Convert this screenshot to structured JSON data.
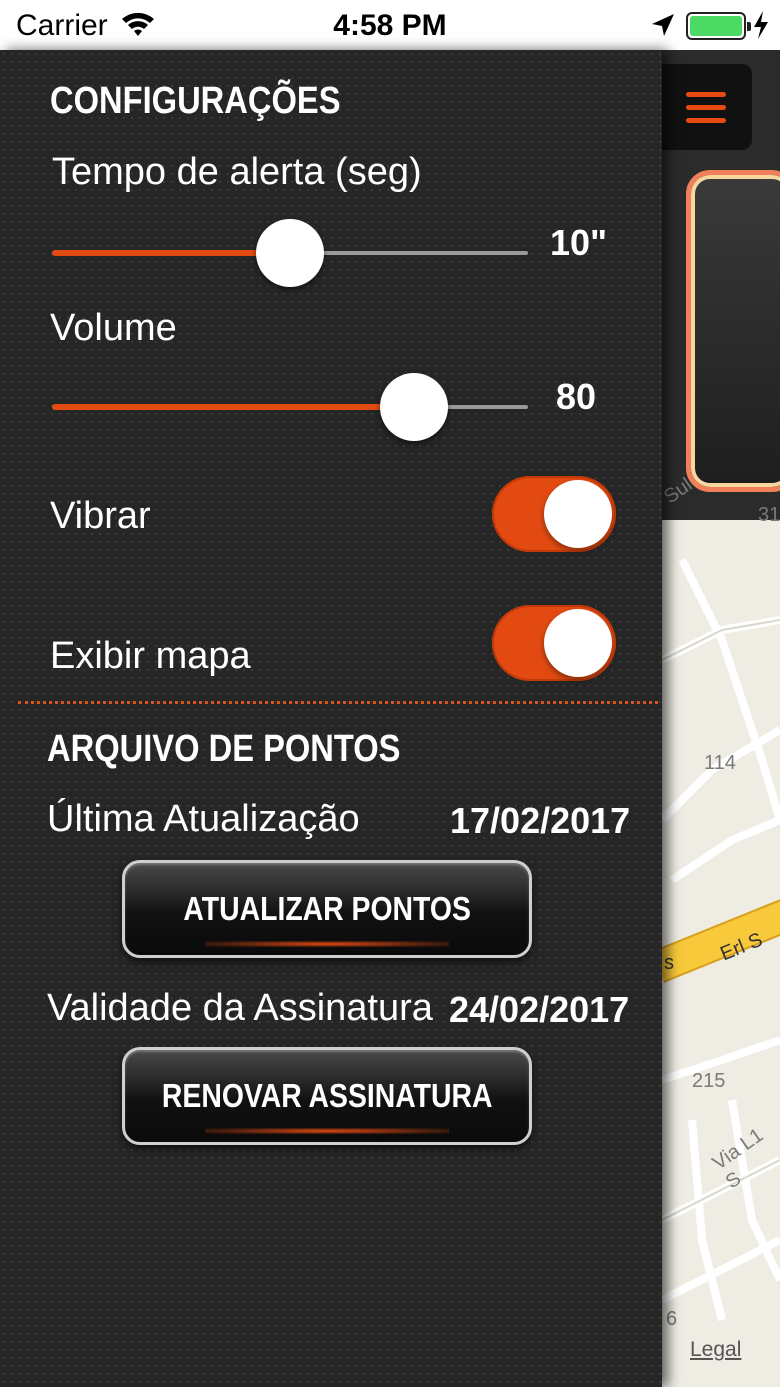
{
  "status_bar": {
    "carrier": "Carrier",
    "time": "4:58 PM",
    "wifi_icon": "wifi-icon",
    "location_icon": "location-arrow-icon",
    "battery_icon": "battery-icon",
    "charging_icon": "charging-bolt-icon",
    "battery_color": "#4cd964"
  },
  "settings": {
    "title": "CONFIGURAÇÕES",
    "alert_time": {
      "label": "Tempo de alerta (seg)",
      "value_text": "10\"",
      "level": 0.5
    },
    "volume": {
      "label": "Volume",
      "value_text": "80",
      "level": 0.76
    },
    "vibrate": {
      "label": "Vibrar",
      "on": true
    },
    "show_map": {
      "label": "Exibir mapa",
      "on": true
    }
  },
  "points_file": {
    "title": "ARQUIVO DE PONTOS",
    "last_update_label": "Última Atualização",
    "last_update_value": "17/02/2017",
    "update_button": "ATUALIZAR PONTOS",
    "subscription_label": "Validade da Assinatura",
    "subscription_value": "24/02/2017",
    "renew_button": "RENOVAR ASSINATURA"
  },
  "map": {
    "menu_icon": "hamburger-menu-icon",
    "labels": [
      "Sul",
      "31",
      "114",
      "Erl S",
      "s",
      "215",
      "Via L1 S",
      "6"
    ],
    "legal": "Legal"
  },
  "colors": {
    "accent": "#e24a12",
    "panel_bg": "#262626",
    "map_bg": "#efece4",
    "road": "#f8c93a"
  }
}
